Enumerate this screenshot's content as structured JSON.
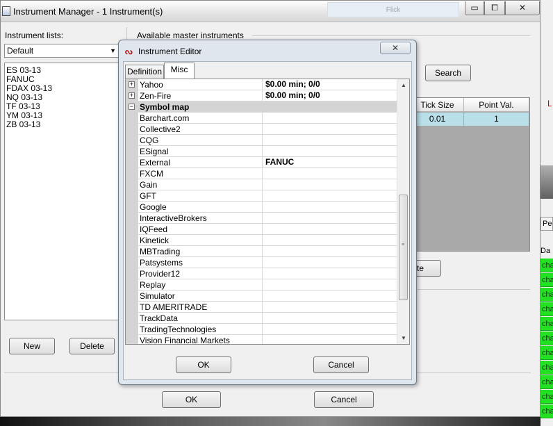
{
  "main_window": {
    "title": "Instrument Manager - 1 Instrument(s)",
    "minimize_glyph": "▭",
    "maximize_glyph": "⧠",
    "close_glyph": "✕",
    "titlebar_ghost_label": "Flick"
  },
  "left_panel": {
    "lists_label": "Instrument lists:",
    "selected_list": "Default",
    "instruments": [
      "ES 03-13",
      "FANUC",
      "FDAX 03-13",
      "NQ 03-13",
      "TF 03-13",
      "YM 03-13",
      "ZB 03-13"
    ],
    "new_label": "New",
    "delete_label": "Delete"
  },
  "right_panel": {
    "available_label": "Available master instruments",
    "search_label": "Search",
    "columns": [
      "Tick Size",
      "Point Val."
    ],
    "row": [
      "0.01",
      "1"
    ],
    "partial_button_label": "te"
  },
  "main_buttons": {
    "ok_label": "OK",
    "cancel_label": "Cancel"
  },
  "background_right": {
    "red_letter": "L",
    "perf_label": "Perf",
    "da_label": "Da",
    "green_rows": [
      "cha",
      "cha",
      "cha",
      "cha",
      "cha",
      "cha",
      "cha",
      "cha",
      "cha",
      "cha",
      "cha"
    ]
  },
  "editor": {
    "title": "Instrument Editor",
    "icon_glyph": "ᔓ",
    "close_glyph": "✕",
    "tabs": [
      "Definition",
      "Misc"
    ],
    "active_tab": "Misc",
    "rows": [
      {
        "kind": "expandable",
        "name": "Yahoo",
        "value": "$0.00 min;  0/0"
      },
      {
        "kind": "expandable",
        "name": "Zen-Fire",
        "value": "$0.00 min;  0/0"
      },
      {
        "kind": "category",
        "name": "Symbol map",
        "value": ""
      },
      {
        "kind": "item",
        "name": "Barchart.com",
        "value": ""
      },
      {
        "kind": "item",
        "name": "Collective2",
        "value": ""
      },
      {
        "kind": "item",
        "name": "CQG",
        "value": ""
      },
      {
        "kind": "item",
        "name": "ESignal",
        "value": ""
      },
      {
        "kind": "item",
        "name": "External",
        "value": "FANUC"
      },
      {
        "kind": "item",
        "name": "FXCM",
        "value": ""
      },
      {
        "kind": "item",
        "name": "Gain",
        "value": ""
      },
      {
        "kind": "item",
        "name": "GFT",
        "value": ""
      },
      {
        "kind": "item",
        "name": "Google",
        "value": ""
      },
      {
        "kind": "item",
        "name": "InteractiveBrokers",
        "value": ""
      },
      {
        "kind": "item",
        "name": "IQFeed",
        "value": ""
      },
      {
        "kind": "item",
        "name": "Kinetick",
        "value": ""
      },
      {
        "kind": "item",
        "name": "MBTrading",
        "value": ""
      },
      {
        "kind": "item",
        "name": "Patsystems",
        "value": ""
      },
      {
        "kind": "item",
        "name": "Provider12",
        "value": ""
      },
      {
        "kind": "item",
        "name": "Replay",
        "value": ""
      },
      {
        "kind": "item",
        "name": "Simulator",
        "value": ""
      },
      {
        "kind": "item",
        "name": "TD AMERITRADE",
        "value": ""
      },
      {
        "kind": "item",
        "name": "TrackData",
        "value": ""
      },
      {
        "kind": "item",
        "name": "TradingTechnologies",
        "value": ""
      },
      {
        "kind": "item",
        "name": "Vision Financial Markets",
        "value": ""
      }
    ],
    "ok_label": "OK",
    "cancel_label": "Cancel"
  }
}
